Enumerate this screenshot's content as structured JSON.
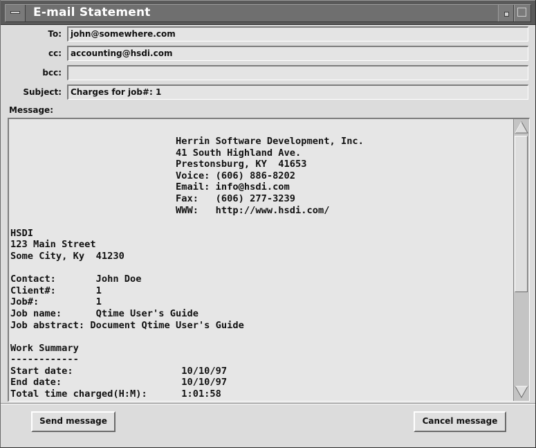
{
  "window": {
    "title": "E-mail Statement"
  },
  "form": {
    "to_label": "To:",
    "to_value": "john@somewhere.com",
    "cc_label": "cc:",
    "cc_value": "accounting@hsdi.com",
    "bcc_label": "bcc:",
    "bcc_value": "",
    "subject_label": "Subject:",
    "subject_value": "Charges for job#: 1",
    "message_label": "Message:"
  },
  "message": {
    "body": "                             Herrin Software Development, Inc.\n                             41 South Highland Ave.\n                             Prestonsburg, KY  41653\n                             Voice: (606) 886-8202\n                             Email: info@hsdi.com\n                             Fax:   (606) 277-3239\n                             WWW:   http://www.hsdi.com/\n\nHSDI\n123 Main Street\nSome City, Ky  41230\n\nContact:       John Doe\nClient#:       1\nJob#:          1\nJob name:      Qtime User's Guide\nJob abstract: Document Qtime User's Guide\n\nWork Summary\n------------\nStart date:                   10/10/97\nEnd date:                     10/10/97\nTotal time charged(H:M):      1:01:58"
  },
  "buttons": {
    "send_label": "Send message",
    "cancel_label": "Cancel message"
  },
  "icons": {
    "window_menu": "window-menu-icon",
    "minimize": "minimize-icon",
    "maximize": "maximize-icon",
    "scroll_up": "up-arrow-icon",
    "scroll_down": "down-arrow-icon"
  }
}
